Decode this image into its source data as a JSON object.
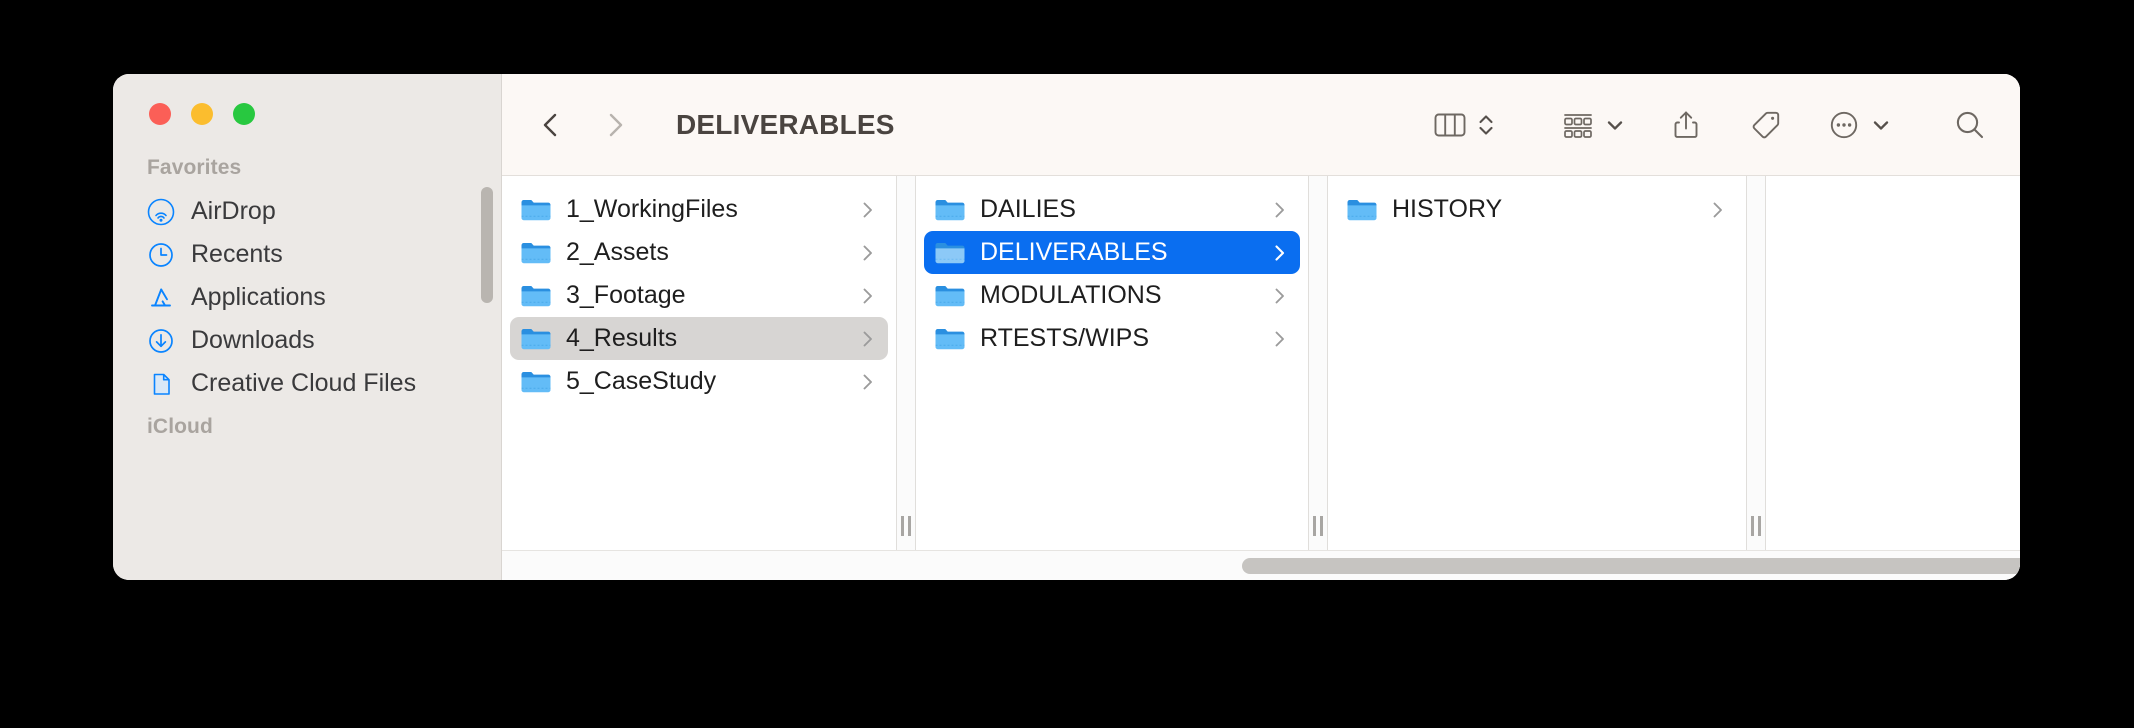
{
  "window": {
    "title": "DELIVERABLES",
    "traffic_lights": [
      {
        "name": "close",
        "color": "#fb5f57"
      },
      {
        "name": "minimize",
        "color": "#fbbd2e"
      },
      {
        "name": "maximize",
        "color": "#28c840"
      }
    ]
  },
  "toolbar": {
    "back_label": "Back",
    "forward_label": "Forward",
    "title": "DELIVERABLES",
    "view_mode": "column-view",
    "view_mode_label": "Column View",
    "group_by_label": "Group By",
    "share_label": "Share",
    "tags_label": "Tags",
    "more_label": "More",
    "search_label": "Search"
  },
  "sidebar": {
    "sections": [
      {
        "title": "Favorites",
        "items": [
          {
            "label": "AirDrop",
            "icon": "airdrop-icon"
          },
          {
            "label": "Recents",
            "icon": "clock-icon"
          },
          {
            "label": "Applications",
            "icon": "applications-icon"
          },
          {
            "label": "Downloads",
            "icon": "download-icon"
          },
          {
            "label": "Creative Cloud Files",
            "icon": "document-icon"
          }
        ]
      },
      {
        "title": "iCloud",
        "items": []
      }
    ]
  },
  "columns": [
    {
      "name": "column-1",
      "items": [
        {
          "label": "1_WorkingFiles",
          "icon": "folder-icon",
          "selected": "none"
        },
        {
          "label": "2_Assets",
          "icon": "folder-icon",
          "selected": "none"
        },
        {
          "label": "3_Footage",
          "icon": "folder-icon",
          "selected": "none"
        },
        {
          "label": "4_Results",
          "icon": "folder-icon",
          "selected": "gray"
        },
        {
          "label": "5_CaseStudy",
          "icon": "folder-icon",
          "selected": "none"
        }
      ]
    },
    {
      "name": "column-2",
      "items": [
        {
          "label": "DAILIES",
          "icon": "folder-icon",
          "selected": "none"
        },
        {
          "label": "DELIVERABLES",
          "icon": "folder-icon",
          "selected": "blue"
        },
        {
          "label": "MODULATIONS",
          "icon": "folder-icon",
          "selected": "none"
        },
        {
          "label": "RTESTS/WIPS",
          "icon": "folder-icon",
          "selected": "none"
        }
      ]
    },
    {
      "name": "column-3",
      "items": [
        {
          "label": "HISTORY",
          "icon": "folder-icon",
          "selected": "none"
        }
      ]
    }
  ],
  "colors": {
    "selection_blue": "#0a6ef0",
    "selection_gray": "#d7d5d3",
    "sidebar_bg": "#ece9e6",
    "toolbar_bg": "#fcf8f5",
    "folder_blue": "#56b6f5",
    "accent_icon_blue": "#0a84ff"
  }
}
